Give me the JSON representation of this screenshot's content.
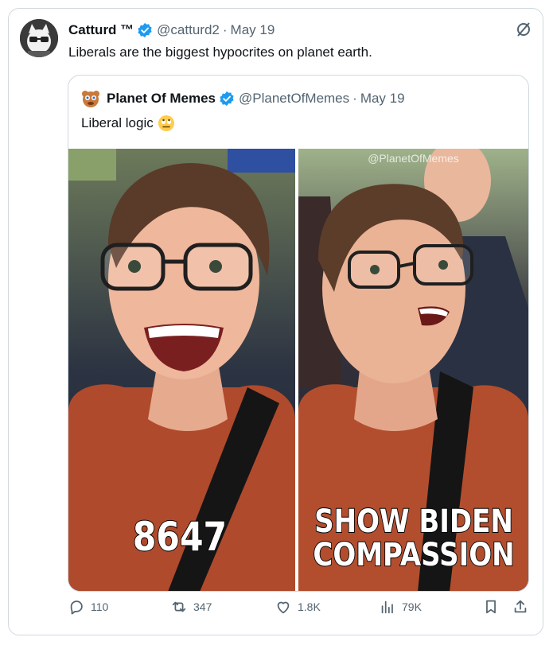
{
  "tweet": {
    "author_name": "Catturd ™",
    "handle": "@catturd2",
    "date": "May 19",
    "separator": "·",
    "text": "Liberals are the biggest hypocrites on planet earth."
  },
  "quote": {
    "author_name": "Planet Of Memes",
    "handle": "@PlanetOfMemes",
    "date": "May 19",
    "separator": "·",
    "text": "Liberal logic",
    "emoji": "rolling-eyes-emoji",
    "media": {
      "watermark": "@PlanetOfMemes",
      "left_caption": "8647",
      "right_caption_line1": "SHOW BIDEN",
      "right_caption_line2": "COMPASSION"
    }
  },
  "actions": {
    "reply_count": "110",
    "retweet_count": "347",
    "like_count": "1.8K",
    "view_count": "79K"
  },
  "colors": {
    "verified": "#1d9bf0",
    "secondary_text": "#536471",
    "border": "#cfd9de"
  }
}
